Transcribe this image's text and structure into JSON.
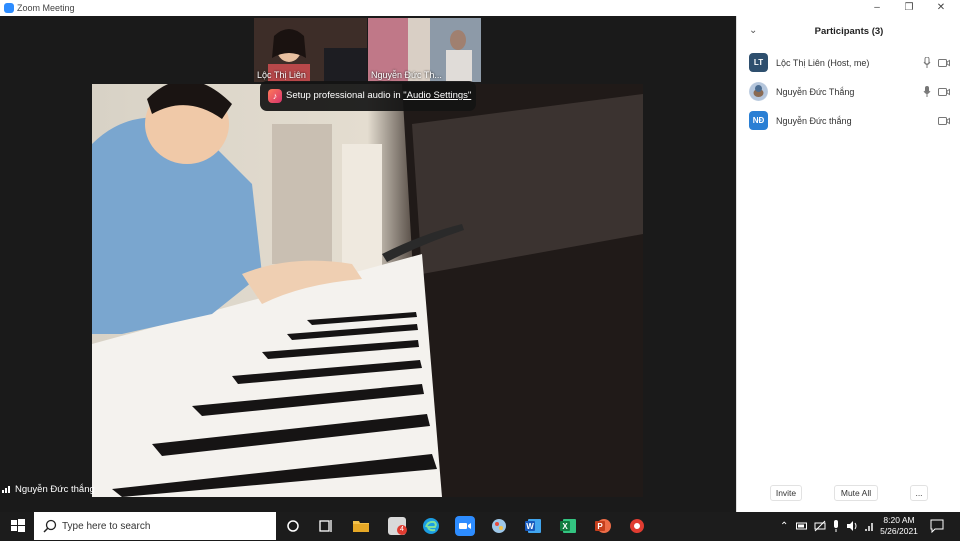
{
  "window": {
    "title": "Zoom Meeting",
    "min": "–",
    "restore": "❐",
    "close": "✕"
  },
  "thumbnails": [
    {
      "name": "Lộc Thị Liên"
    },
    {
      "name": "Nguyễn Đức Th..."
    }
  ],
  "toast": {
    "prefix": "Setup professional audio in ",
    "link": "\"Audio Settings\""
  },
  "active_speaker": {
    "name": "Nguyễn Đức thắng"
  },
  "participants_panel": {
    "title": "Participants (3)",
    "collapse": "⌄",
    "list": [
      {
        "initials": "LT",
        "name": "Lộc Thị Liên (Host, me)",
        "avatar_color": "#2e4f6e",
        "mic_muted": false
      },
      {
        "initials": "",
        "name": "Nguyễn Đức Thắng",
        "avatar_color": "#c6d4e4",
        "mic_muted": false
      },
      {
        "initials": "NĐ",
        "name": "Nguyễn Đức thắng",
        "avatar_color": "#2a7fd4",
        "mic_muted": true
      }
    ],
    "buttons": {
      "invite": "Invite",
      "mute_all": "Mute All",
      "more": "..."
    }
  },
  "taskbar": {
    "search_placeholder": "Type here to search",
    "mail_badge": "4",
    "apps": [
      "start-icon",
      "task-view-icon",
      "timeline-icon",
      "file-explorer-icon",
      "mail-icon",
      "edge-icon",
      "zoom-icon",
      "paint-icon",
      "word-icon",
      "excel-icon",
      "powerpoint-icon",
      "screen-recorder-icon"
    ],
    "tray": [
      "show-hidden-icons",
      "battery-icon",
      "network-off-icon",
      "microphone-icon",
      "volume-icon",
      "wifi-icon"
    ],
    "time": "8:20 AM",
    "date": "5/26/2021",
    "notifications": "notification-icon"
  },
  "colors": {
    "accent": "#2d8cff",
    "taskbar": "#1c1c1c",
    "panel_bg": "#ffffff"
  }
}
